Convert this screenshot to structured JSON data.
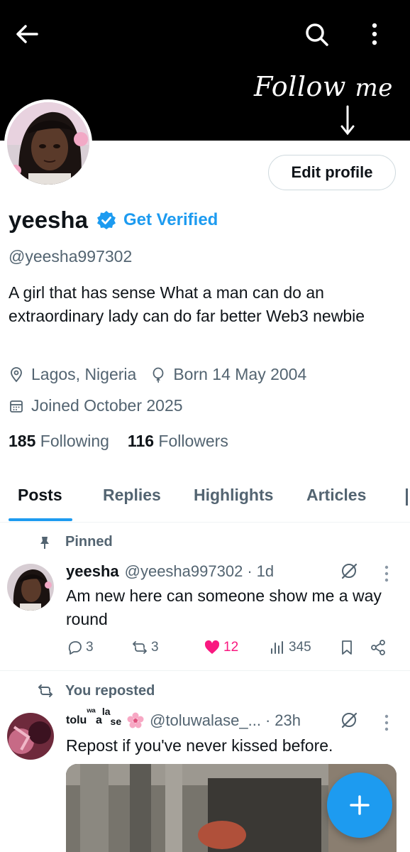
{
  "header": {
    "banner_text_1": "Follow",
    "banner_text_2": "me",
    "back_icon": "arrow-left-icon",
    "search_icon": "search-icon",
    "more_icon": "more-vertical-icon"
  },
  "profile": {
    "edit_label": "Edit profile",
    "name": "yeesha",
    "get_verified": "Get Verified",
    "handle": "@yeesha997302",
    "bio": "A girl that has sense What a man can do an extraordinary lady can do far better  Web3 newbie",
    "location": "Lagos, Nigeria",
    "birthday": "Born 14 May 2004",
    "joined": "Joined October 2025",
    "following_count": "185",
    "following_label": "Following",
    "followers_count": "116",
    "followers_label": "Followers"
  },
  "tabs": [
    {
      "label": "Posts",
      "active": true
    },
    {
      "label": "Replies"
    },
    {
      "label": "Highlights"
    },
    {
      "label": "Articles"
    }
  ],
  "posts": [
    {
      "context": "Pinned",
      "name": "yeesha",
      "handle": "@yeesha997302",
      "dot": "·",
      "time": "1d",
      "text": "Am new here can someone show me a way round",
      "replies": "3",
      "reposts": "3",
      "likes": "12",
      "views": "345"
    },
    {
      "context": "You reposted",
      "name_parts": [
        "tolu",
        "ʷᵃ",
        "a",
        "la",
        "se"
      ],
      "handle": "@toluwalase_...",
      "dot": "·",
      "time": "23h",
      "text": "Repost if you've never kissed before."
    }
  ],
  "colors": {
    "accent": "#1d9bf0",
    "like": "#f91880",
    "muted": "#536471",
    "text": "#0f1419"
  }
}
